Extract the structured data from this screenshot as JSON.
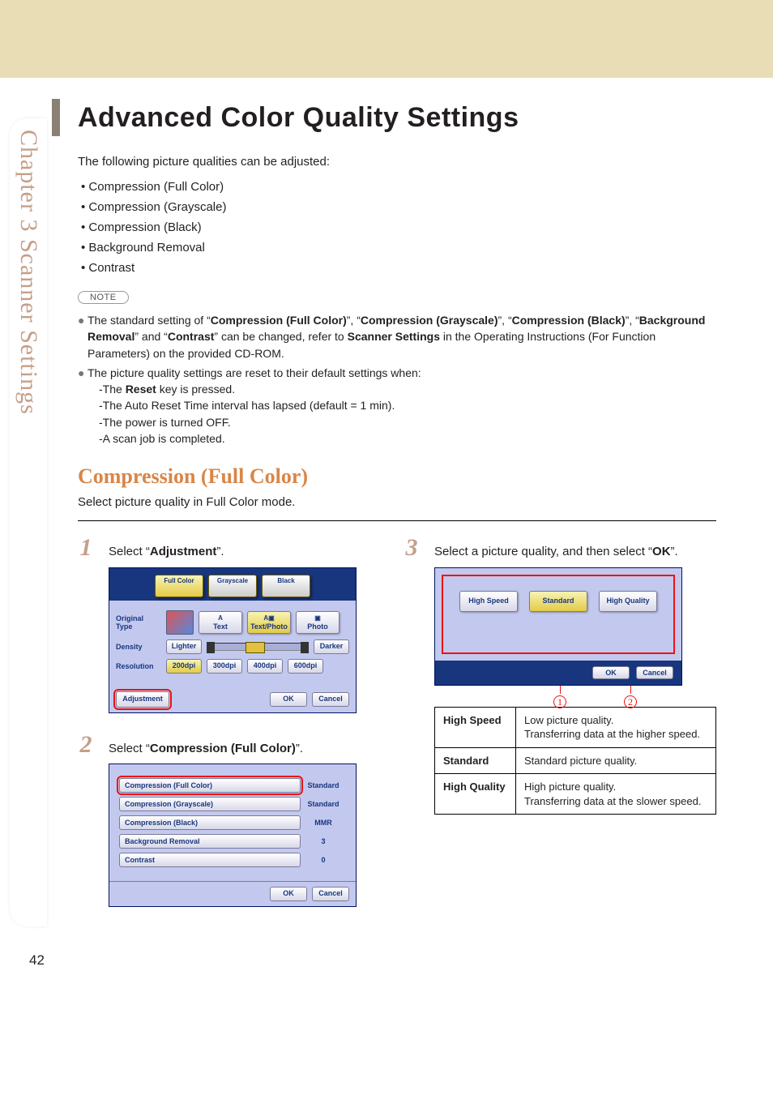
{
  "sidebar_label": "Chapter 3    Scanner Settings",
  "page_number": "42",
  "title": "Advanced Color Quality Settings",
  "intro": "The following picture qualities can be adjusted:",
  "quality_list": [
    "Compression (Full Color)",
    "Compression (Grayscale)",
    "Compression (Black)",
    "Background Removal",
    "Contrast"
  ],
  "note_label": "NOTE",
  "note1": {
    "pre": "The standard setting of “",
    "b1": "Compression (Full Color)",
    "s1": "”, “",
    "b2": "Compression (Grayscale)",
    "s2": "”, “",
    "b3": "Compression (Black)",
    "s3": "”, “",
    "b4": "Background Removal",
    "s4": "” and “",
    "b5": "Contrast",
    "s5": "” can be changed, refer to ",
    "b6": "Scanner Settings",
    "post": " in the Operating Instructions (For Function Parameters) on the provided CD-ROM."
  },
  "note2_intro": "The picture quality settings are reset to their default settings when:",
  "note2_lines": {
    "l1a": "-The ",
    "l1b": "Reset",
    "l1c": " key is pressed.",
    "l2": "-The Auto Reset Time interval has lapsed (default = 1 min).",
    "l3": "-The power is turned OFF.",
    "l4": "-A scan job is completed."
  },
  "section_heading": "Compression (Full Color)",
  "section_desc": "Select picture quality in Full Color mode.",
  "steps": {
    "1": {
      "a": "Select “",
      "b": "Adjustment",
      "c": "”."
    },
    "2": {
      "a": "Select “",
      "b": "Compression (Full Color)",
      "c": "”."
    },
    "3": {
      "a": "Select a picture quality, and then select “",
      "b": "OK",
      "c": "”."
    }
  },
  "screen1": {
    "tabs": {
      "full_color": "Full Color",
      "grayscale": "Grayscale",
      "black": "Black"
    },
    "orig_label": "Original Type",
    "types": {
      "text": "Text",
      "textphoto": "Text/Photo",
      "photo": "Photo"
    },
    "density_label": "Density",
    "lighter": "Lighter",
    "darker": "Darker",
    "res_label": "Resolution",
    "res": {
      "r1": "200dpi",
      "r2": "300dpi",
      "r3": "400dpi",
      "r4": "600dpi"
    },
    "adjustment": "Adjustment",
    "ok": "OK",
    "cancel": "Cancel"
  },
  "screen2": {
    "items": {
      "i1": {
        "label": "Compression (Full Color)",
        "value": "Standard"
      },
      "i2": {
        "label": "Compression (Grayscale)",
        "value": "Standard"
      },
      "i3": {
        "label": "Compression (Black)",
        "value": "MMR"
      },
      "i4": {
        "label": "Background Removal",
        "value": "3"
      },
      "i5": {
        "label": "Contrast",
        "value": "0"
      }
    },
    "ok": "OK",
    "cancel": "Cancel"
  },
  "screen3": {
    "opts": {
      "o1": "High Speed",
      "o2": "Standard",
      "o3": "High Quality"
    },
    "ok": "OK",
    "cancel": "Cancel",
    "callout1": "1",
    "callout2": "2"
  },
  "qt": {
    "r1h": "High Speed",
    "r1d": "Low picture quality.\nTransferring data at the higher speed.",
    "r2h": "Standard",
    "r2d": "Standard picture quality.",
    "r3h": "High Quality",
    "r3d": "High picture quality.\nTransferring data at the slower speed."
  }
}
